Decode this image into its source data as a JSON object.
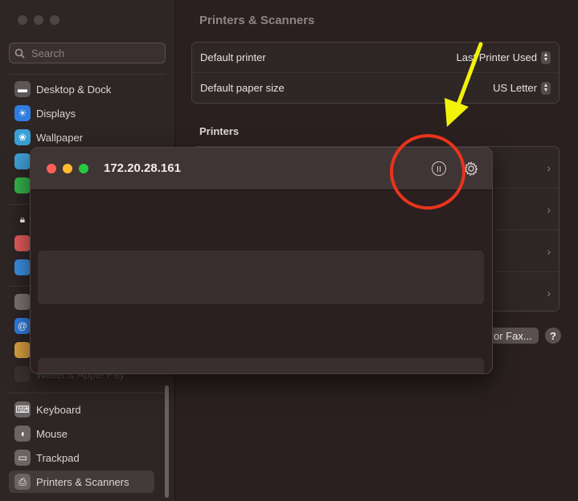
{
  "sidebar": {
    "search_placeholder": "Search",
    "items": [
      {
        "label": "Desktop & Dock",
        "icon": "desktop-dock-icon"
      },
      {
        "label": "Displays",
        "icon": "displays-icon"
      },
      {
        "label": "Wallpaper",
        "icon": "wallpaper-icon"
      },
      {
        "label": "Wallet & Apple Pay",
        "icon": "wallet-icon"
      },
      {
        "label": "Keyboard",
        "icon": "keyboard-icon"
      },
      {
        "label": "Mouse",
        "icon": "mouse-icon"
      },
      {
        "label": "Trackpad",
        "icon": "trackpad-icon"
      },
      {
        "label": "Printers & Scanners",
        "icon": "printer-icon",
        "selected": true
      }
    ]
  },
  "main": {
    "title": "Printers & Scanners",
    "default_printer_label": "Default printer",
    "default_printer_value": "Last Printer Used",
    "paper_size_label": "Default paper size",
    "paper_size_value": "US Letter",
    "printers_heading": "Printers",
    "fax_button": "or Fax...",
    "help_button": "?"
  },
  "queue_window": {
    "title": "172.20.28.161",
    "pause_icon": "pause-icon",
    "settings_icon": "gear-icon"
  },
  "annotations": {
    "arrow_color": "#f2f20a",
    "circle_color": "#e8341c"
  },
  "colors": {
    "close": "#fe5f57",
    "minimize": "#febc2e",
    "zoom": "#28c840"
  }
}
